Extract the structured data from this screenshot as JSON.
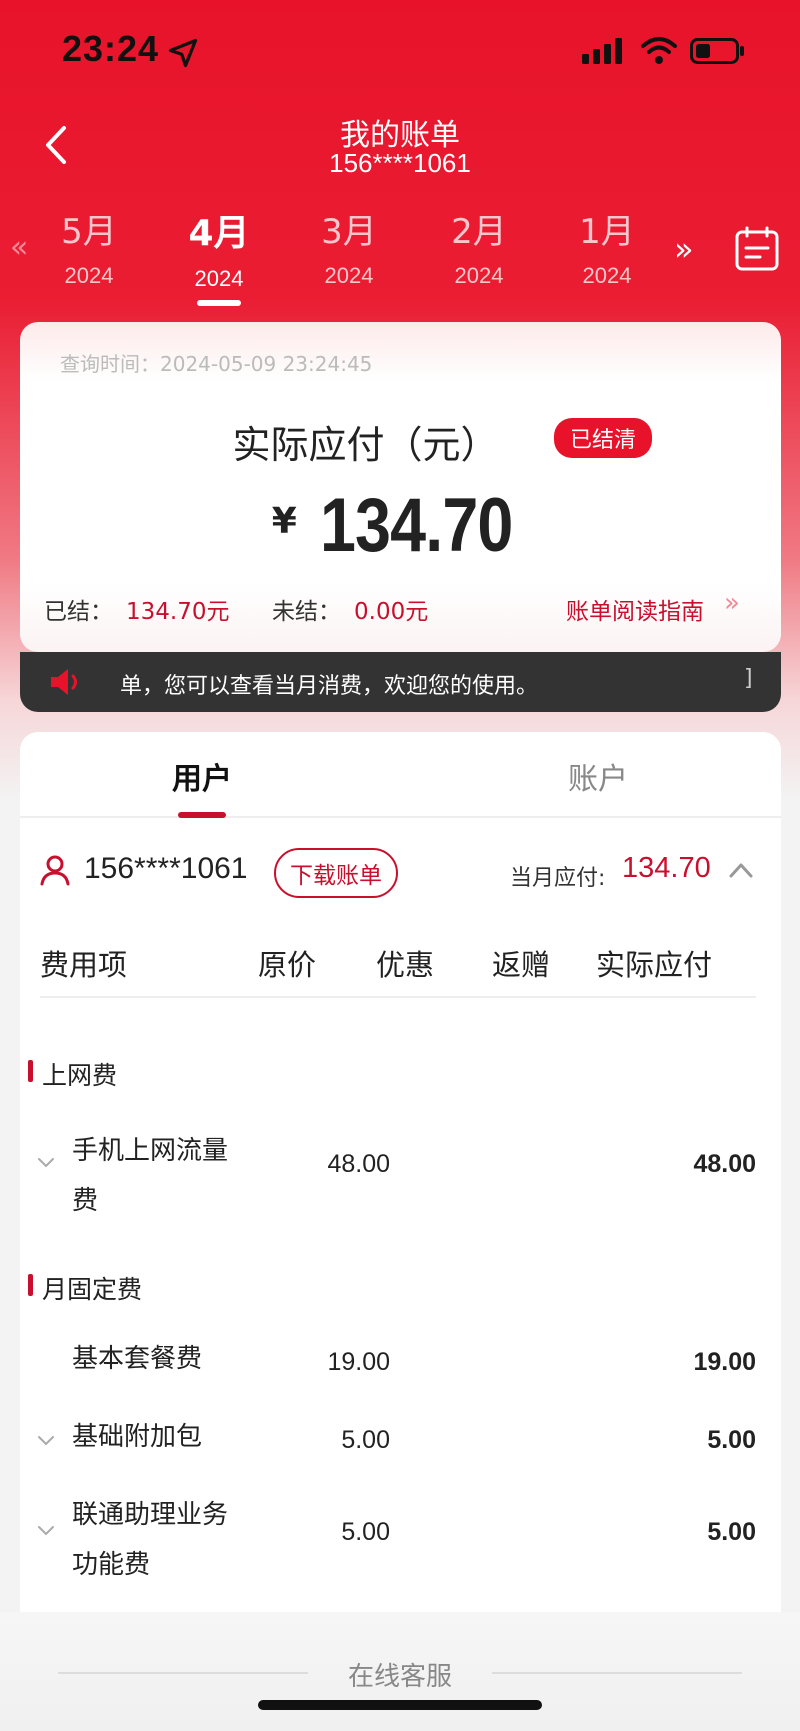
{
  "status": {
    "time": "23:24"
  },
  "header": {
    "title": "我的账单",
    "subtitle": "156****1061"
  },
  "months": [
    {
      "month": "5月",
      "year": "2024"
    },
    {
      "month": "4月",
      "year": "2024"
    },
    {
      "month": "3月",
      "year": "2024"
    },
    {
      "month": "2月",
      "year": "2024"
    },
    {
      "month": "1月",
      "year": "2024"
    }
  ],
  "active_month_index": 1,
  "summary": {
    "query_time": "查询时间：2024-05-09 23:24:45",
    "pay_label": "实际应付（元）",
    "badge": "已结清",
    "currency": "¥",
    "amount": "134.70",
    "settled_label": "已结：",
    "settled_value": "134.70元",
    "unsettled_label": "未结：",
    "unsettled_value": "0.00元",
    "guide_link": "账单阅读指南"
  },
  "notice": {
    "text": "单，您可以查看当月消费，欢迎您的使用。",
    "end": "]"
  },
  "tabs": [
    {
      "label": "用户"
    },
    {
      "label": "账户"
    }
  ],
  "user": {
    "number": "156****1061",
    "download_label": "下载账单",
    "due_label": "当月应付:",
    "due_value": "134.70"
  },
  "table": {
    "headers": [
      "费用项",
      "原价",
      "优惠",
      "返赠",
      "实际应付"
    ],
    "sections": [
      {
        "title": "上网费",
        "items": [
          {
            "name": "手机上网流量费",
            "original": "48.00",
            "discount": "",
            "rebate": "",
            "actual": "48.00",
            "expandable": true
          }
        ]
      },
      {
        "title": "月固定费",
        "items": [
          {
            "name": "基本套餐费",
            "original": "19.00",
            "discount": "",
            "rebate": "",
            "actual": "19.00",
            "expandable": false
          },
          {
            "name": "基础附加包",
            "original": "5.00",
            "discount": "",
            "rebate": "",
            "actual": "5.00",
            "expandable": true
          },
          {
            "name": "联通助理业务功能费",
            "original": "5.00",
            "discount": "",
            "rebate": "",
            "actual": "5.00",
            "expandable": true
          }
        ]
      }
    ]
  },
  "footer": {
    "label": "在线客服"
  },
  "colors": {
    "brand_red": "#e8132b",
    "text_red": "#c8102e",
    "notice_bg": "#333333"
  }
}
